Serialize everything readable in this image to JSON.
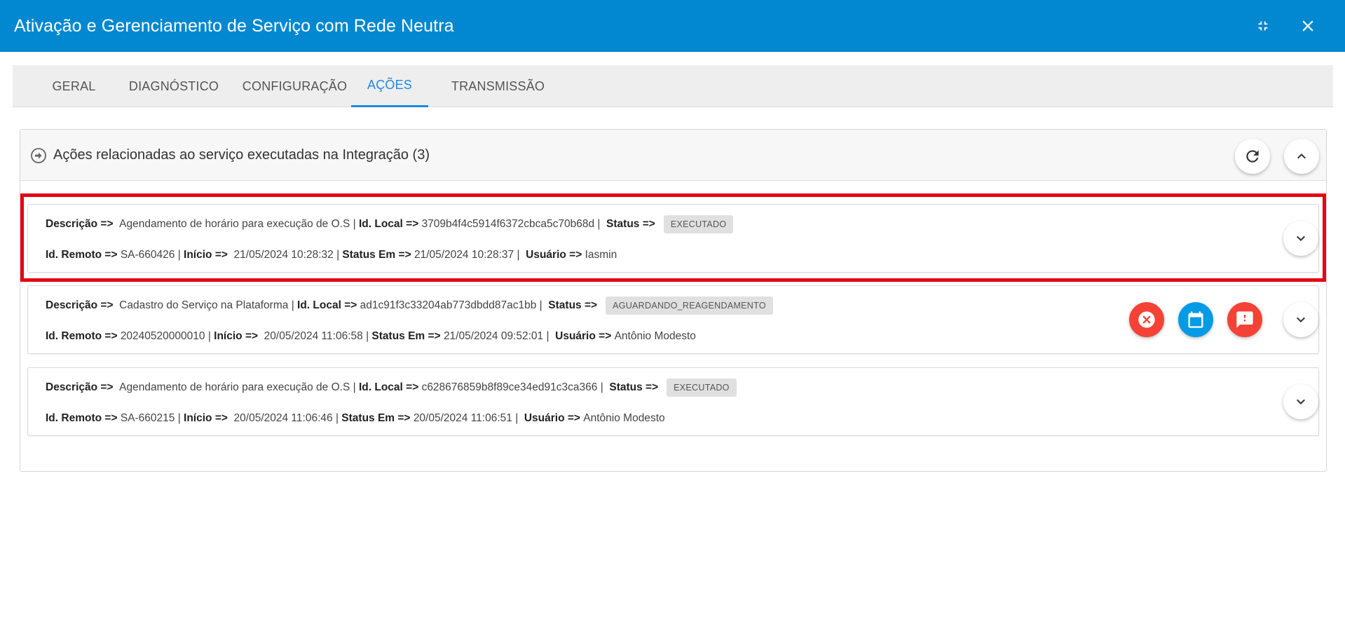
{
  "window": {
    "title": "Ativação e Gerenciamento de Serviço com Rede Neutra",
    "compress_icon": "compress-icon",
    "close_icon": "close-icon"
  },
  "tabs": [
    {
      "label": "GERAL",
      "active": false
    },
    {
      "label": "DIAGNÓSTICO",
      "active": false
    },
    {
      "label": "CONFIGURAÇÃO",
      "active": false
    },
    {
      "label": "AÇÕES",
      "active": true
    },
    {
      "label": "TRANSMISSÃO",
      "active": false
    }
  ],
  "panel": {
    "title": "Ações relacionadas ao serviço executadas na Integração (3)",
    "header_icon": "arrow-circle-right-icon",
    "refresh_icon": "refresh-icon",
    "collapse_icon": "chevron-up-icon"
  },
  "labels": {
    "descricao": "Descrição =>",
    "id_local": "Id. Local =>",
    "status": "Status =>",
    "id_remoto": "Id. Remoto =>",
    "inicio": "Início =>",
    "status_em": "Status Em =>",
    "usuario": "Usuário =>",
    "sep": "|"
  },
  "actions": [
    {
      "descricao": "Agendamento de horário para execução de O.S",
      "id_local": "3709b4f4c5914f6372cbca5c70b68d",
      "status": "EXECUTADO",
      "id_remoto": "SA-660426",
      "inicio": "21/05/2024 10:28:32",
      "status_em": "21/05/2024 10:28:37",
      "usuario": "Iasmin",
      "highlighted": true
    },
    {
      "descricao": "Cadastro do Serviço na Plataforma",
      "id_local": "ad1c91f3c33204ab773dbdd87ac1bb",
      "status": "AGUARDANDO_REAGENDAMENTO",
      "id_remoto": "20240520000010",
      "inicio": "20/05/2024 11:06:58",
      "status_em": "21/05/2024 09:52:01",
      "usuario": "Antônio Modesto",
      "buttons": [
        "cancel-icon",
        "calendar-icon",
        "report-icon"
      ]
    },
    {
      "descricao": "Agendamento de horário para execução de O.S",
      "id_local": "c628676859b8f89ce34ed91c3ca366",
      "status": "EXECUTADO",
      "id_remoto": "SA-660215",
      "inicio": "20/05/2024 11:06:46",
      "status_em": "20/05/2024 11:06:51",
      "usuario": "Antônio Modesto"
    }
  ],
  "colors": {
    "titlebar": "#0288d1",
    "tab_active": "#1e88e5",
    "highlight": "#e30613",
    "danger": "#f44336",
    "info": "#039be5"
  }
}
